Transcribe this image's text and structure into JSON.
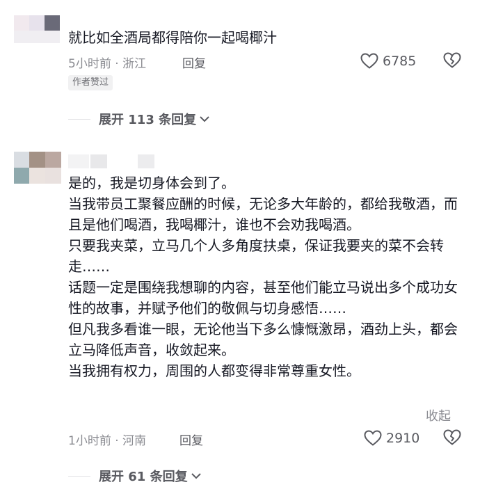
{
  "comment1": {
    "text": "就比如全酒局都得陪你一起喝椰汁",
    "time_location": "5小时前 · 浙江",
    "reply_label": "回复",
    "like_count": "6785",
    "author_liked_tag": "作者赞过",
    "expand_replies": "展开 113 条回复"
  },
  "comment2": {
    "paragraphs": [
      "是的，我是切身体会到了。",
      "当我带员工聚餐应酬的时候，无论多大年龄的，都给我敬酒，而且是他们喝酒，我喝椰汁，谁也不会劝我喝酒。",
      "只要我夹菜，立马几个人多角度扶桌，保证我要夹的菜不会转走……",
      "话题一定是围绕我想聊的内容，甚至他们能立马说出多个成功女性的故事，并赋予他们的敬佩与切身感悟……",
      "但凡我多看谁一眼，无论他当下多么慷慨激昂，酒劲上头，都会立马降低声音，收敛起来。",
      "当我拥有权力，周围的人都变得非常尊重女性。"
    ],
    "collapse_label": "收起",
    "time_location": "1小时前 · 河南",
    "reply_label": "回复",
    "like_count": "2910",
    "expand_replies": "展开 61 条回复"
  },
  "colors": {
    "text_primary": "#161823",
    "text_secondary": "#8a8b91",
    "divider": "#e3e3e5",
    "tag_bg": "#f1f1f2"
  },
  "icons": {
    "like": "heart-outline-icon",
    "dislike": "broken-heart-icon",
    "expand": "chevron-down-icon"
  }
}
